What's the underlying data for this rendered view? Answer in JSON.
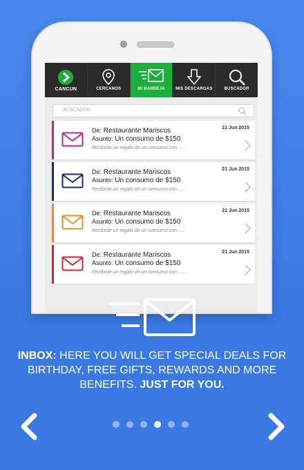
{
  "nav": {
    "items": [
      {
        "label": "CANCUN",
        "icon": "play-logo-icon",
        "active": false
      },
      {
        "label": "CERCANOS",
        "icon": "location-pin-icon",
        "active": false
      },
      {
        "label": "MI BANDEJA",
        "icon": "inbox-envelope-icon",
        "active": true
      },
      {
        "label": "MIS DESCARGAS",
        "icon": "download-arrow-icon",
        "active": false
      },
      {
        "label": "BUSCADOR",
        "icon": "search-icon",
        "active": false
      }
    ]
  },
  "search": {
    "placeholder": "BUSCADOR"
  },
  "messages": [
    {
      "from_label": "De:",
      "from": "Restaurante Mariscos",
      "subject_label": "Asunto:",
      "subject": "Un consumo de $150",
      "preview": "Recibiste un regalo de un consumo con ......",
      "date": "21 Jun 2015",
      "color": "#c2228d"
    },
    {
      "from_label": "De:",
      "from": "Restaurante Mariscos",
      "subject_label": "Asunto:",
      "subject": "Un consumo de $150",
      "preview": "Recibiste un regalo de un consumo con ......",
      "date": "21 Jun 2015",
      "color": "#1c237a"
    },
    {
      "from_label": "De:",
      "from": "Restaurante Mariscos",
      "subject_label": "Asunto:",
      "subject": "Un consumo de $150",
      "preview": "Recibiste un regalo de un consumo con .....",
      "date": "21 Jun 2015",
      "color": "#f28a23"
    },
    {
      "from_label": "De:",
      "from": "Restaurante Mariscos",
      "subject_label": "Asunto:",
      "subject": "Un consumo de $150",
      "preview": "Recibiste un regalo de un consumo con ......",
      "date": "21 Jun 2015",
      "color": "#e0202c"
    }
  ],
  "caption": {
    "lead": "INBOX:",
    "body": " HERE YOU WILL GET SPECIAL DEALS FOR BIRTHDAY, FREE GIFTS, REWARDS AND MORE BENEFITS. ",
    "tail": "JUST FOR YOU."
  },
  "pager": {
    "total": 6,
    "current": 4
  },
  "colors": {
    "accent_green": "#1fae3d",
    "background_blue": "#3a79e4",
    "nav_dark": "#2b2b2b"
  }
}
